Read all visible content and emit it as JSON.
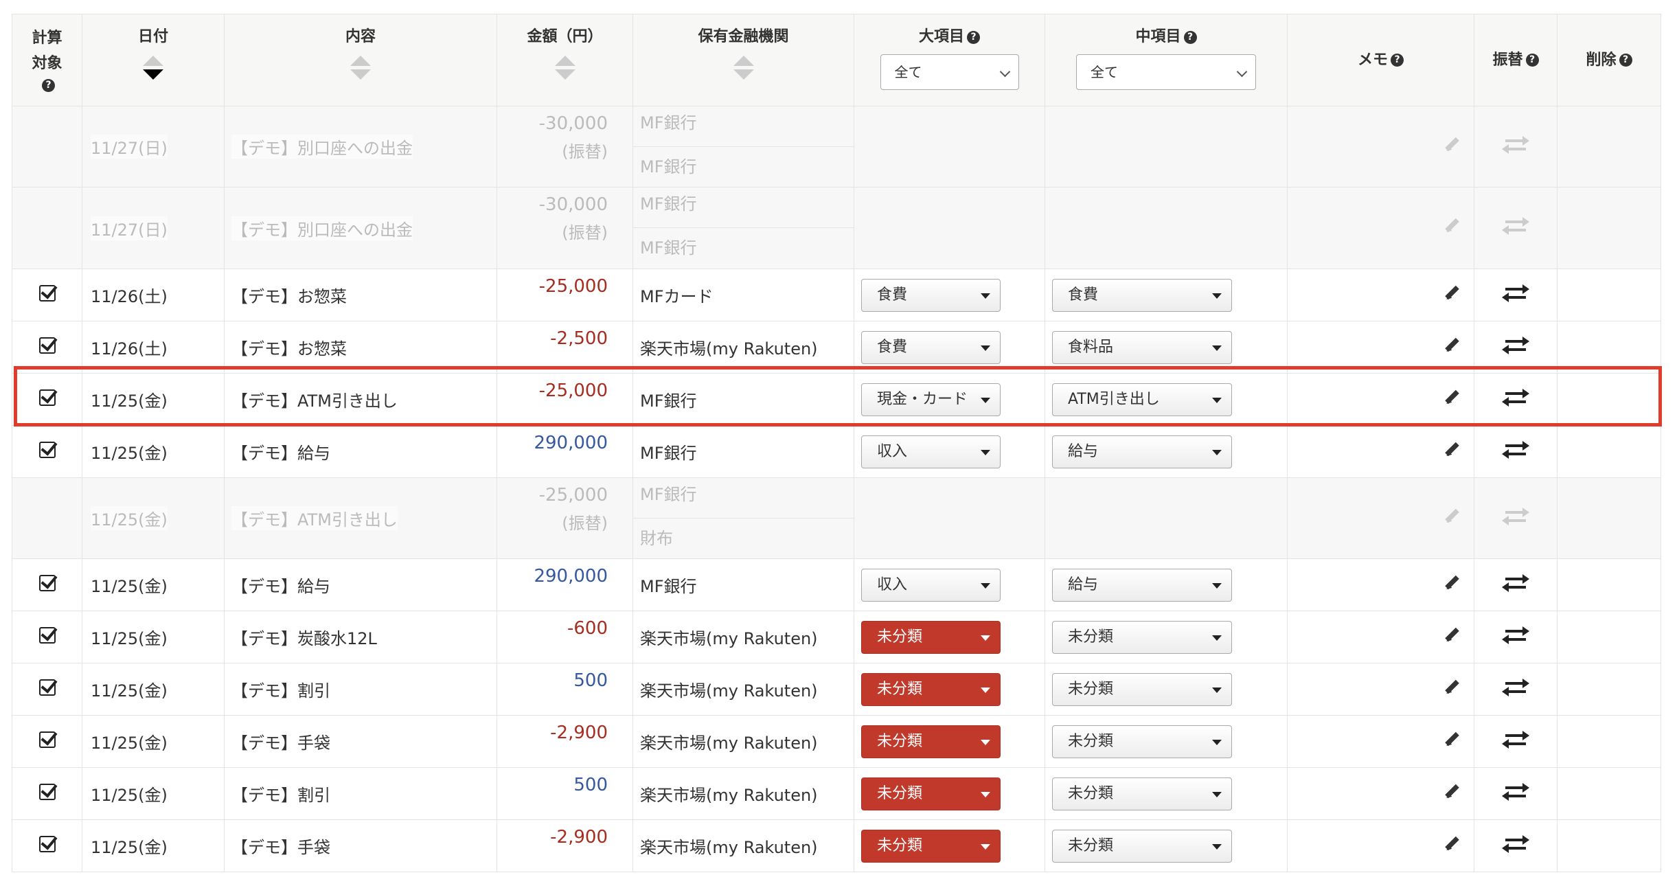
{
  "header": {
    "calc_target": "計算対象",
    "date": "日付",
    "content": "内容",
    "amount": "金額（円）",
    "institution": "保有金融機関",
    "major_category": "大項目",
    "mid_category": "中項目",
    "memo": "メモ",
    "transfer": "振替",
    "delete": "削除",
    "help_glyph": "?",
    "major_filter": "全て",
    "mid_filter": "全て"
  },
  "highlight_color": "#e03c2b",
  "category_alert_color": "#c0392b",
  "rows": [
    {
      "date": "11/27(日)",
      "desc": "【デモ】別口座への出金",
      "amount": "-30,000",
      "amount_sub": "(振替)",
      "inst1": "MF銀行",
      "inst2": "MF銀行"
    },
    {
      "date": "11/27(日)",
      "desc": "【デモ】別口座への出金",
      "amount": "-30,000",
      "amount_sub": "(振替)",
      "inst1": "MF銀行",
      "inst2": "MF銀行"
    },
    {
      "date": "11/26(土)",
      "desc": "【デモ】お惣菜",
      "amount": "-25,000",
      "inst": "MFカード",
      "major": "食費",
      "mid": "食費"
    },
    {
      "date": "11/26(土)",
      "desc": "【デモ】お惣菜",
      "amount": "-2,500",
      "inst": "楽天市場(my Rakuten)",
      "major": "食費",
      "mid": "食料品"
    },
    {
      "date": "11/25(金)",
      "desc": "【デモ】ATM引き出し",
      "amount": "-25,000",
      "inst": "MF銀行",
      "major": "現金・カード",
      "mid": "ATM引き出し"
    },
    {
      "date": "11/25(金)",
      "desc": "【デモ】給与",
      "amount": "290,000",
      "inst": "MF銀行",
      "major": "収入",
      "mid": "給与"
    },
    {
      "date": "11/25(金)",
      "desc": "【デモ】ATM引き出し",
      "amount": "-25,000",
      "amount_sub": "(振替)",
      "inst1": "MF銀行",
      "inst2": "財布"
    },
    {
      "date": "11/25(金)",
      "desc": "【デモ】給与",
      "amount": "290,000",
      "inst": "MF銀行",
      "major": "収入",
      "mid": "給与"
    },
    {
      "date": "11/25(金)",
      "desc": "【デモ】炭酸水12L",
      "amount": "-600",
      "inst": "楽天市場(my Rakuten)",
      "major": "未分類",
      "mid": "未分類"
    },
    {
      "date": "11/25(金)",
      "desc": "【デモ】割引",
      "amount": "500",
      "inst": "楽天市場(my Rakuten)",
      "major": "未分類",
      "mid": "未分類"
    },
    {
      "date": "11/25(金)",
      "desc": "【デモ】手袋",
      "amount": "-2,900",
      "inst": "楽天市場(my Rakuten)",
      "major": "未分類",
      "mid": "未分類"
    },
    {
      "date": "11/25(金)",
      "desc": "【デモ】割引",
      "amount": "500",
      "inst": "楽天市場(my Rakuten)",
      "major": "未分類",
      "mid": "未分類"
    },
    {
      "date": "11/25(金)",
      "desc": "【デモ】手袋",
      "amount": "-2,900",
      "inst": "楽天市場(my Rakuten)",
      "major": "未分類",
      "mid": "未分類"
    }
  ]
}
